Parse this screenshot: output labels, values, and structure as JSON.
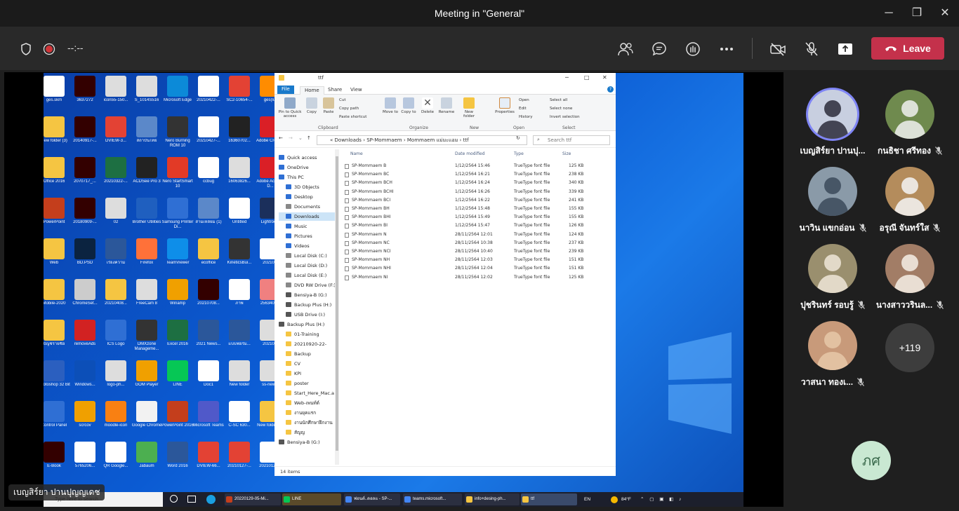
{
  "window": {
    "title": "Meeting in \"General\"",
    "controls": {
      "minimize": "─",
      "maximize": "❐",
      "close": "✕"
    }
  },
  "toolbar": {
    "timer": "--:--",
    "leave_label": "Leave",
    "accent": "#c4314b"
  },
  "shared_screen": {
    "presenter_chip": "เบญสิร์ยา ปานปุญญเดช",
    "desktop_icons": [
      {
        "label": "ges.skm",
        "color": "#ffffff"
      },
      {
        "label": "3637272",
        "color": "#330000"
      },
      {
        "label": "icon55-150...",
        "color": "#dddddd"
      },
      {
        "label": "S_1014S516",
        "color": "#dddddd"
      },
      {
        "label": "Microsoft Edge",
        "color": "#0c8ad8"
      },
      {
        "label": "20210422-...",
        "color": "#ffffff"
      },
      {
        "label": "SC2-10654-...",
        "color": "#e34234"
      },
      {
        "label": "ges(lu)",
        "color": "#ff8c00"
      },
      {
        "label": "New folder (3)",
        "color": "#f5c542"
      },
      {
        "label": "20140917-...",
        "color": "#330000"
      },
      {
        "label": "DVIEW-3...",
        "color": "#e34234"
      },
      {
        "label": "สถาบันไทย",
        "color": "#5b88c9"
      },
      {
        "label": "Nero Burning ROM 10",
        "color": "#333333"
      },
      {
        "label": "20210427-...",
        "color": "#ffffff"
      },
      {
        "label": "16360702...",
        "color": "#222222"
      },
      {
        "label": "Adobe Creati...",
        "color": "#da1f26"
      },
      {
        "label": "Office 2016",
        "color": "#f5c542"
      },
      {
        "label": "2070717_...",
        "color": "#330000"
      },
      {
        "label": "20210322-...",
        "color": "#1d6f42"
      },
      {
        "label": "ACDSee Pro 3",
        "color": "#222222"
      },
      {
        "label": "Nero StartSmart 10",
        "color": "#e23a26"
      },
      {
        "label": "ccbug",
        "color": "#ffffff"
      },
      {
        "label": "16063826...",
        "color": "#dddddd"
      },
      {
        "label": "Adobe Acrobat D...",
        "color": "#da1f26"
      },
      {
        "label": "PowerPoint",
        "color": "#c43e1c"
      },
      {
        "label": "20180909-...",
        "color": "#330000"
      },
      {
        "label": "02",
        "color": "#dddddd"
      },
      {
        "label": "Brother Utilities",
        "color": "#1f5fbf"
      },
      {
        "label": "Samsung Printer Di...",
        "color": "#2f6fd4"
      },
      {
        "label": "สามเหลี่ยม (1)",
        "color": "#5b88c9"
      },
      {
        "label": "Untitled",
        "color": "#ffffff"
      },
      {
        "label": "Lightroom",
        "color": "#1b2f5b"
      },
      {
        "label": "Web",
        "color": "#f5c542"
      },
      {
        "label": "BD.PSD",
        "color": "#0b2340"
      },
      {
        "label": "เรียงความ",
        "color": "#2b579a"
      },
      {
        "label": "Firefox",
        "color": "#ff7139"
      },
      {
        "label": "TeamViewer",
        "color": "#0e8ee9"
      },
      {
        "label": "ecoffice",
        "color": "#f5c542"
      },
      {
        "label": "KineticsBui...",
        "color": "#333333"
      },
      {
        "label": "20210...",
        "color": "#ffffff"
      },
      {
        "label": "Mobile-2020",
        "color": "#f5c542"
      },
      {
        "label": "ChromeSet...",
        "color": "#cccccc"
      },
      {
        "label": "20210408...",
        "color": "#f5c542"
      },
      {
        "label": "FreeCam 8",
        "color": "#dddddd"
      },
      {
        "label": "Winamp",
        "color": "#f0a000"
      },
      {
        "label": "20210708...",
        "color": "#330000"
      },
      {
        "label": "ภาพ",
        "color": "#ffffff"
      },
      {
        "label": "2563404...",
        "color": "#f08080"
      },
      {
        "label": "บัญชีรายชื่อ",
        "color": "#f5c542"
      },
      {
        "label": "removeAds",
        "color": "#d22222"
      },
      {
        "label": "ICS Logo",
        "color": "#2f6fd4"
      },
      {
        "label": "DMXzone Manageme...",
        "color": "#333333"
      },
      {
        "label": "Excel 2016",
        "color": "#1d6f42"
      },
      {
        "label": "2021 News...",
        "color": "#2b579a"
      },
      {
        "label": "แบบฟอร์ม...",
        "color": "#2b579a"
      },
      {
        "label": "20210...",
        "color": "#dddddd"
      },
      {
        "label": "Photoshop 32 Bit",
        "color": "#2b5fbf"
      },
      {
        "label": "Windows...",
        "color": "#0c4fb8"
      },
      {
        "label": "logo-ph...",
        "color": "#dddddd"
      },
      {
        "label": "GOM Player",
        "color": "#f0a000"
      },
      {
        "label": "LINE",
        "color": "#06c755"
      },
      {
        "label": "Doc1",
        "color": "#ffffff"
      },
      {
        "label": "New folder",
        "color": "#dddddd"
      },
      {
        "label": "ss-new...",
        "color": "#dddddd"
      },
      {
        "label": "Control Panel",
        "color": "#2f6fd4"
      },
      {
        "label": "scrcov",
        "color": "#f0a000"
      },
      {
        "label": "moodle-icon",
        "color": "#f98012"
      },
      {
        "label": "Google Chrome",
        "color": "#f2f2f2"
      },
      {
        "label": "PowerPoint 2016",
        "color": "#c43e1c"
      },
      {
        "label": "Microsoft Teams",
        "color": "#5059c9"
      },
      {
        "label": "C-SC 630...",
        "color": "#ffffff"
      },
      {
        "label": "New folder (2)",
        "color": "#f5c542"
      },
      {
        "label": "E-Book",
        "color": "#330000"
      },
      {
        "label": "5765206...",
        "color": "#ffffff"
      },
      {
        "label": "QR Google...",
        "color": "#ffffff"
      },
      {
        "label": "Jabaum",
        "color": "#4caf50"
      },
      {
        "label": "Word 2016",
        "color": "#2b579a"
      },
      {
        "label": "DVIEW-66...",
        "color": "#e34234"
      },
      {
        "label": "20210127-...",
        "color": "#e34234"
      },
      {
        "label": "20210125...",
        "color": "#ffffff"
      }
    ],
    "explorer": {
      "title": "ttf",
      "tabs": [
        "File",
        "Home",
        "Share",
        "View"
      ],
      "ribbon": {
        "clipboard": {
          "group": "Clipboard",
          "pin": "Pin to Quick access",
          "copy": "Copy",
          "paste": "Paste",
          "cut": "Cut",
          "copy_path": "Copy path",
          "paste_shortcut": "Paste shortcut"
        },
        "organize": {
          "group": "Organize",
          "move_to": "Move to",
          "copy_to": "Copy to",
          "delete": "Delete",
          "rename": "Rename"
        },
        "new": {
          "group": "New",
          "new_folder": "New folder"
        },
        "open": {
          "group": "Open",
          "properties": "Properties",
          "open": "Open",
          "edit": "Edit",
          "history": "History"
        },
        "select": {
          "group": "Select",
          "select_all": "Select all",
          "select_none": "Select none",
          "invert": "Invert selection"
        }
      },
      "address": {
        "crumbs": [
          "Downloads",
          "SP-Mommaem",
          "Mommaem แม่มะแอม",
          "ttf"
        ],
        "separator": "›",
        "search_placeholder": "Search ttf"
      },
      "nav": [
        {
          "label": "Quick access",
          "color": "#2f6fd4",
          "indent": 0
        },
        {
          "label": "OneDrive",
          "color": "#2f6fd4",
          "indent": 0
        },
        {
          "label": "This PC",
          "color": "#2f6fd4",
          "indent": 0
        },
        {
          "label": "3D Objects",
          "color": "#2f6fd4",
          "indent": 1
        },
        {
          "label": "Desktop",
          "color": "#2f6fd4",
          "indent": 1
        },
        {
          "label": "Documents",
          "color": "#888888",
          "indent": 1
        },
        {
          "label": "Downloads",
          "color": "#2f6fd4",
          "indent": 1,
          "selected": true
        },
        {
          "label": "Music",
          "color": "#2f6fd4",
          "indent": 1
        },
        {
          "label": "Pictures",
          "color": "#2f6fd4",
          "indent": 1
        },
        {
          "label": "Videos",
          "color": "#2f6fd4",
          "indent": 1
        },
        {
          "label": "Local Disk (C:)",
          "color": "#888888",
          "indent": 1
        },
        {
          "label": "Local Disk (D:)",
          "color": "#888888",
          "indent": 1
        },
        {
          "label": "Local Disk (E:)",
          "color": "#888888",
          "indent": 1
        },
        {
          "label": "DVD RW Drive (F:)",
          "color": "#888888",
          "indent": 1
        },
        {
          "label": "Bensiya-B (G:)",
          "color": "#555555",
          "indent": 1
        },
        {
          "label": "Backup Plus (H:)",
          "color": "#555555",
          "indent": 1
        },
        {
          "label": "USB Drive (I:)",
          "color": "#555555",
          "indent": 1
        },
        {
          "label": "Backup Plus (H:)",
          "color": "#555555",
          "indent": 0
        },
        {
          "label": "01-Training",
          "color": "#f5c542",
          "indent": 1
        },
        {
          "label": "20210920-22-",
          "color": "#f5c542",
          "indent": 1
        },
        {
          "label": "Backup",
          "color": "#f5c542",
          "indent": 1
        },
        {
          "label": "CV",
          "color": "#f5c542",
          "indent": 1
        },
        {
          "label": "KPI",
          "color": "#f5c542",
          "indent": 1
        },
        {
          "label": "poster",
          "color": "#f5c542",
          "indent": 1
        },
        {
          "label": "Start_Here_Mac.a",
          "color": "#f5c542",
          "indent": 1
        },
        {
          "label": "Web-เพนท์ต์",
          "color": "#f5c542",
          "indent": 1
        },
        {
          "label": "งานยุคแรก",
          "color": "#f5c542",
          "indent": 1
        },
        {
          "label": "งานนักศึกษาฝึกงาน",
          "color": "#f5c542",
          "indent": 1
        },
        {
          "label": "สัญญ",
          "color": "#f5c542",
          "indent": 1
        },
        {
          "label": "Bensiya-B (G:)",
          "color": "#555555",
          "indent": 0
        }
      ],
      "columns": [
        "Name",
        "Date modified",
        "Type",
        "Size"
      ],
      "files": [
        {
          "name": "SP-Mommaem B",
          "date": "1/12/2564 15:46",
          "type": "TrueType font file",
          "size": "125 KB"
        },
        {
          "name": "SP-Mommaem BC",
          "date": "1/12/2564 16:21",
          "type": "TrueType font file",
          "size": "238 KB"
        },
        {
          "name": "SP-Mommaem BCH",
          "date": "1/12/2564 16:24",
          "type": "TrueType font file",
          "size": "340 KB"
        },
        {
          "name": "SP-Mommaem BCHI",
          "date": "1/12/2564 16:26",
          "type": "TrueType font file",
          "size": "339 KB"
        },
        {
          "name": "SP-Mommaem BCI",
          "date": "1/12/2564 16:22",
          "type": "TrueType font file",
          "size": "241 KB"
        },
        {
          "name": "SP-Mommaem BH",
          "date": "1/12/2564 15:48",
          "type": "TrueType font file",
          "size": "155 KB"
        },
        {
          "name": "SP-Mommaem BHI",
          "date": "1/12/2564 15:49",
          "type": "TrueType font file",
          "size": "155 KB"
        },
        {
          "name": "SP-Mommaem BI",
          "date": "1/12/2564 15:47",
          "type": "TrueType font file",
          "size": "126 KB"
        },
        {
          "name": "SP-Mommaem N",
          "date": "28/11/2564 12:01",
          "type": "TrueType font file",
          "size": "124 KB"
        },
        {
          "name": "SP-Mommaem NC",
          "date": "28/11/2564 10:38",
          "type": "TrueType font file",
          "size": "237 KB"
        },
        {
          "name": "SP-Mommaem NCI",
          "date": "28/11/2564 10:40",
          "type": "TrueType font file",
          "size": "239 KB"
        },
        {
          "name": "SP-Mommaem NH",
          "date": "28/11/2564 12:03",
          "type": "TrueType font file",
          "size": "151 KB"
        },
        {
          "name": "SP-Mommaem NHI",
          "date": "28/11/2564 12:04",
          "type": "TrueType font file",
          "size": "151 KB"
        },
        {
          "name": "SP-Mommaem NI",
          "date": "28/11/2564 12:02",
          "type": "TrueType font file",
          "size": "125 KB"
        }
      ],
      "status": "14 items"
    },
    "taskbar": {
      "search_placeholder": "Type here to search",
      "apps": [
        {
          "label": "20220129-05-Mi...",
          "color": "#c43e1c"
        },
        {
          "label": "LINE",
          "color": "#06c755"
        },
        {
          "label": "ฟอนต์..ดอลแ - SP-...",
          "color": "#4285f4"
        },
        {
          "label": "teams.microsoft...",
          "color": "#4285f4"
        },
        {
          "label": "info+desing-ph...",
          "color": "#f5c542"
        },
        {
          "label": "ttf",
          "color": "#f5c542"
        }
      ],
      "lang": "EN",
      "weather": "84°F"
    }
  },
  "participants": [
    {
      "name": "เบญสิร์ยา ปานปุ...",
      "muted": false,
      "speaking": true,
      "bg": "#c8cfe0",
      "fg": "#2b2b3a"
    },
    {
      "name": "กนธิชา ศรีทอง",
      "muted": true,
      "speaking": false,
      "bg": "#6f8a4e",
      "fg": "#f0f0f0"
    },
    {
      "name": "นาวิน แขกอ่อน",
      "muted": true,
      "speaking": false,
      "bg": "#8a9aa8",
      "fg": "#3b4a5a"
    },
    {
      "name": "อรุณี จันทร์ใส",
      "muted": true,
      "speaking": false,
      "bg": "#b48c5c",
      "fg": "#f4f4f4"
    },
    {
      "name": "ปุชรินทร์ รอบรู้",
      "muted": true,
      "speaking": false,
      "bg": "#9a8f6e",
      "fg": "#efe6d8"
    },
    {
      "name": "นางสาววรินล...",
      "muted": true,
      "speaking": false,
      "bg": "#a27d66",
      "fg": "#f6efe6"
    },
    {
      "name": "วาสนา ทองเ...",
      "muted": true,
      "speaking": false,
      "bg": "#c89a7a",
      "fg": "#e6c8a8"
    }
  ],
  "overflow_count": "+119",
  "self_avatar": "ภศ"
}
